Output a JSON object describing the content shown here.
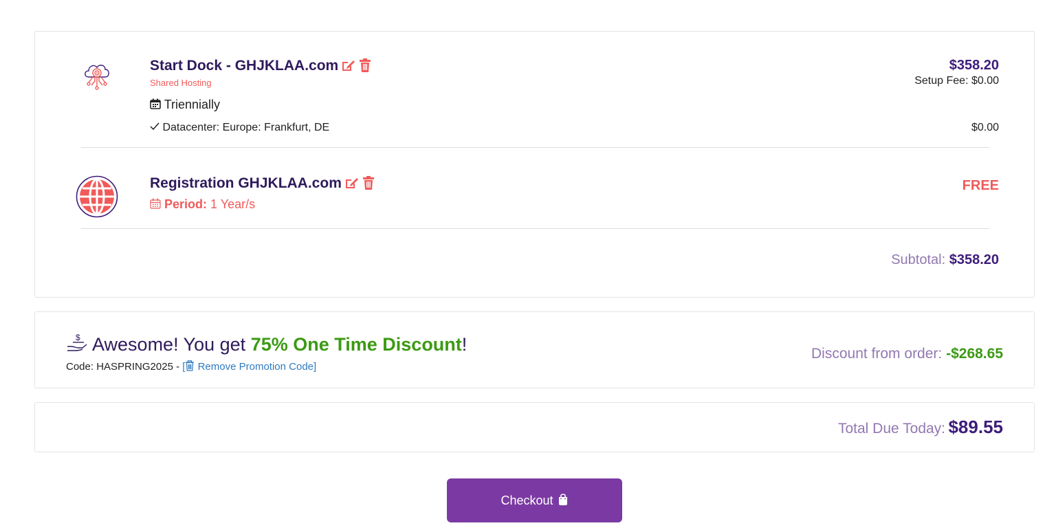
{
  "items": [
    {
      "title": "Start Dock - GHJKLAA.com",
      "subtitle": "Shared Hosting",
      "billing_cycle": "Triennially",
      "option": "Datacenter: Europe: Frankfurt, DE",
      "price": "$358.20",
      "setup_fee": "Setup Fee: $0.00",
      "option_price": "$0.00",
      "icon": "cloud-network-icon"
    },
    {
      "title": "Registration GHJKLAA.com",
      "period_label": "Period:",
      "period_value": "1 Year/s",
      "price": "FREE",
      "icon": "globe-icon"
    }
  ],
  "subtotal": {
    "label": "Subtotal:",
    "value": "$358.20"
  },
  "promo": {
    "prefix": "Awesome! You get ",
    "highlight": "75% One Time Discount",
    "suffix": "!",
    "code_text": "Code: HASPRING2025 - ",
    "remove_link": "[",
    "remove_label": "Remove Promotion Code]",
    "discount_label": "Discount from order:",
    "discount_value": "-$268.65"
  },
  "total": {
    "label": "Total Due Today:",
    "value": "$89.55"
  },
  "checkout": {
    "label": "Checkout"
  },
  "colors": {
    "accent_purple": "#7b3aa3",
    "title_purple": "#2e1a5c",
    "coral": "#f15a5a",
    "green": "#3c9a14",
    "muted_purple": "#9278b0",
    "link_blue": "#2f7bbf"
  }
}
